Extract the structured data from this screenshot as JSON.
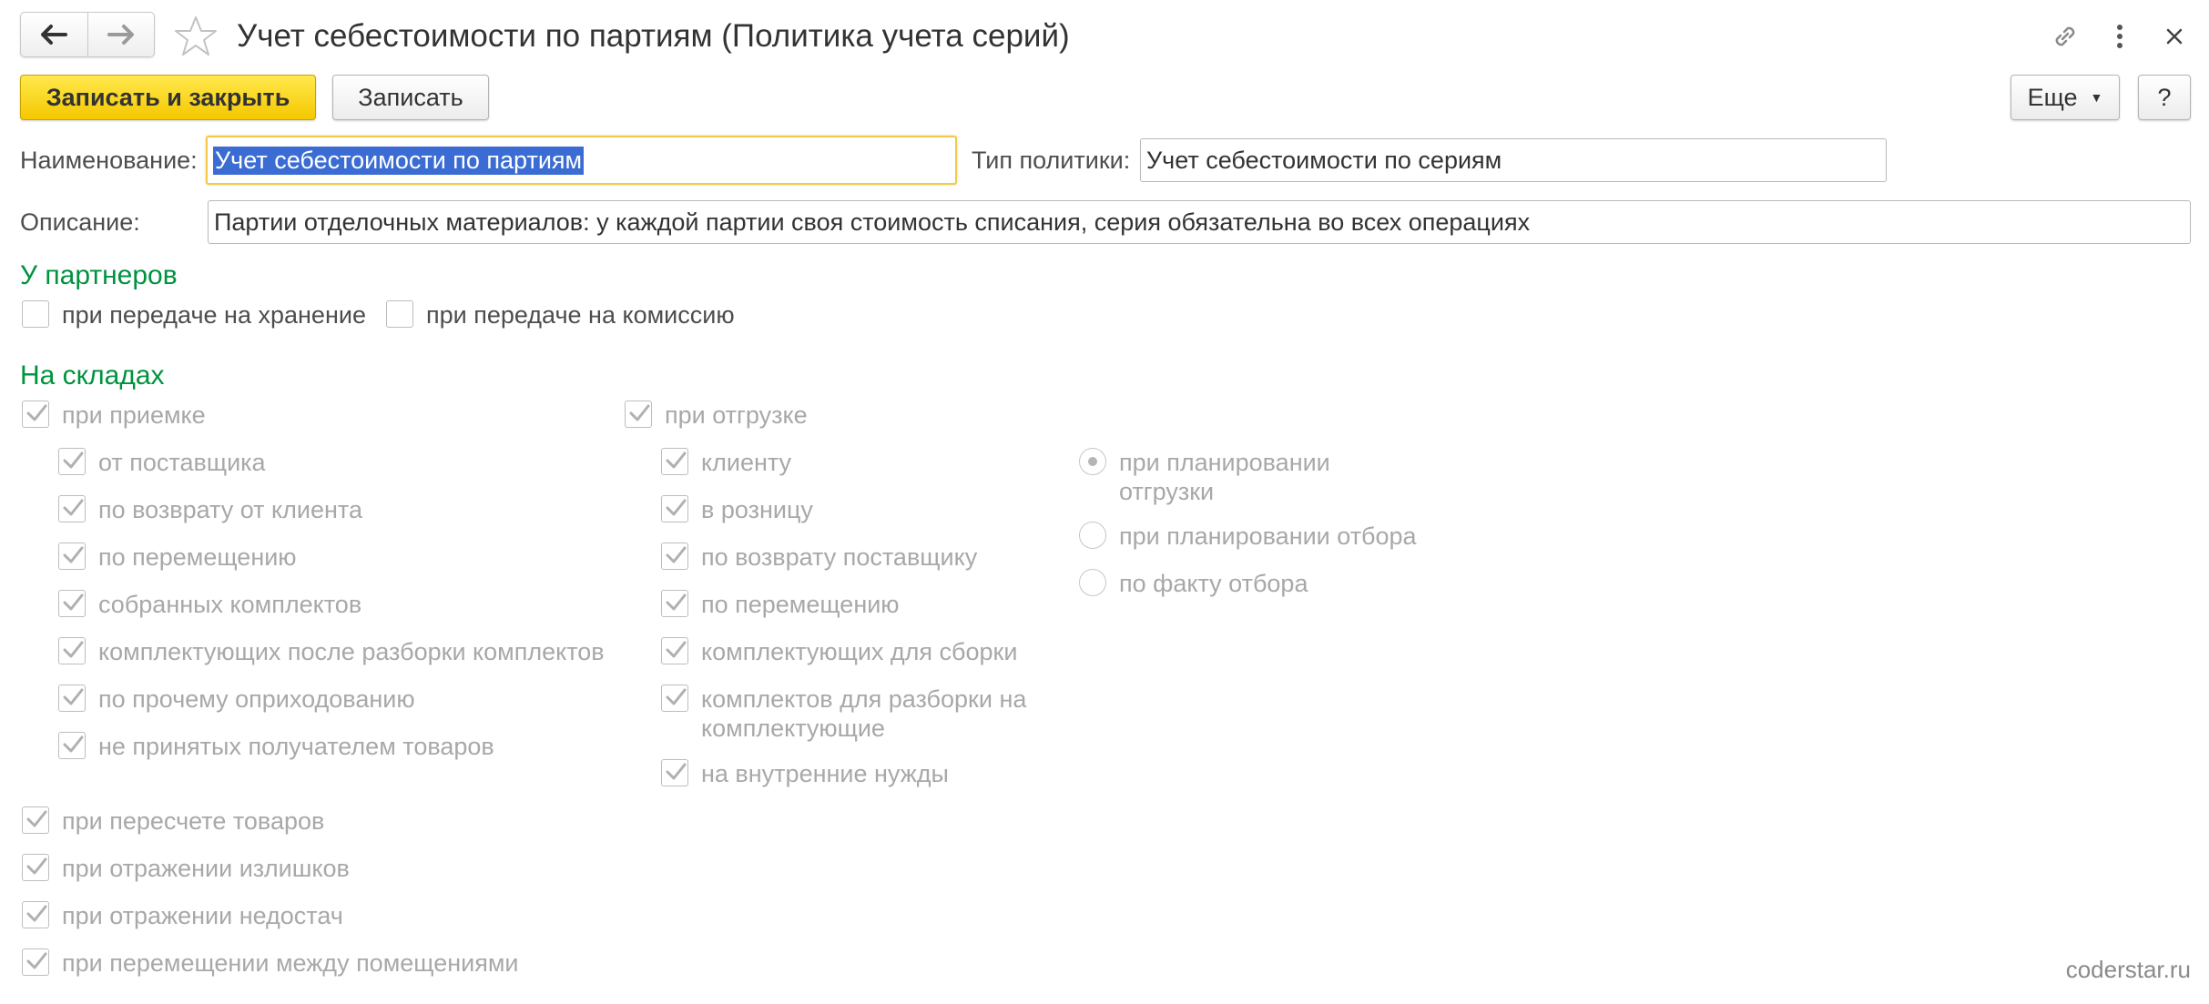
{
  "window": {
    "title": "Учет себестоимости по партиям (Политика учета серий)"
  },
  "toolbar": {
    "save_close_label": "Записать и закрыть",
    "save_label": "Записать",
    "more_label": "Еще",
    "help_label": "?"
  },
  "form": {
    "name_label": "Наименование:",
    "name_value": "Учет себестоимости по партиям",
    "policy_type_label": "Тип политики:",
    "policy_type_value": "Учет себестоимости по сериям",
    "description_label": "Описание:",
    "description_value": "Партии отделочных материалов: у каждой партии своя стоимость списания, серия обязательна во всех операциях"
  },
  "partners": {
    "title": "У партнеров",
    "items": [
      {
        "label": "при передаче на хранение",
        "checked": false
      },
      {
        "label": "при передаче на комиссию",
        "checked": false
      }
    ]
  },
  "warehouses": {
    "title": "На складах",
    "receiving": {
      "label": "при приемке",
      "checked": true,
      "items": [
        {
          "label": "от поставщика",
          "checked": true
        },
        {
          "label": "по возврату от клиента",
          "checked": true
        },
        {
          "label": "по перемещению",
          "checked": true
        },
        {
          "label": "собранных комплектов",
          "checked": true
        },
        {
          "label": "комплектующих после разборки комплектов",
          "checked": true
        },
        {
          "label": "по прочему оприходованию",
          "checked": true
        },
        {
          "label": "не принятых получателем товаров",
          "checked": true
        }
      ]
    },
    "shipping": {
      "label": "при отгрузке",
      "checked": true,
      "items": [
        {
          "label": "клиенту",
          "checked": true
        },
        {
          "label": "в розницу",
          "checked": true
        },
        {
          "label": "по возврату поставщику",
          "checked": true
        },
        {
          "label": "по перемещению",
          "checked": true
        },
        {
          "label": "комплектующих для сборки",
          "checked": true
        },
        {
          "label": "комплектов для разборки на комплектующие",
          "checked": true
        },
        {
          "label": "на внутренние нужды",
          "checked": true
        }
      ]
    },
    "shipping_mode": {
      "options": [
        {
          "label": "при планировании отгрузки",
          "selected": true
        },
        {
          "label": "при планировании отбора",
          "selected": false
        },
        {
          "label": "по факту отбора",
          "selected": false
        }
      ]
    },
    "other": [
      {
        "label": "при пересчете товаров",
        "checked": true
      },
      {
        "label": "при отражении излишков",
        "checked": true
      },
      {
        "label": "при отражении недостач",
        "checked": true
      },
      {
        "label": "при перемещении между помещениями",
        "checked": true
      }
    ]
  },
  "footer": {
    "watermark": "coderstar.ru"
  },
  "colors": {
    "accent_green": "#00923f",
    "primary_button": "#f5c800",
    "selection": "#3b6cd4",
    "disabled_text": "#a8a8a8"
  }
}
